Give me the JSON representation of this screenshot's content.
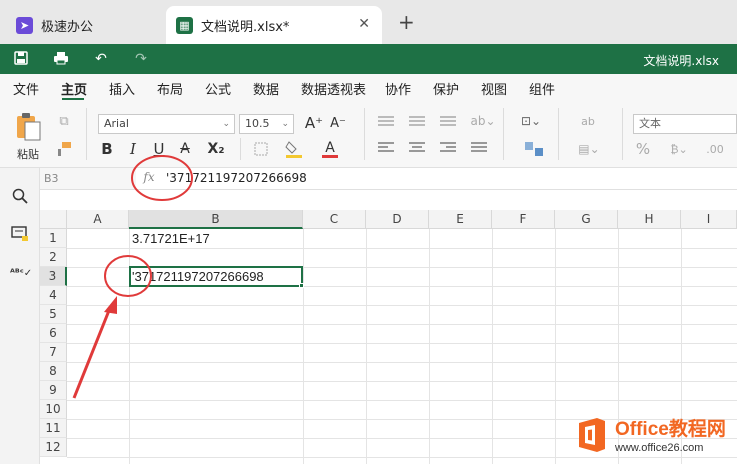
{
  "tabs": [
    {
      "label": "极速办公",
      "icon": "rocket-icon"
    },
    {
      "label": "文档说明.xlsx*",
      "icon": "spreadsheet-icon",
      "close": "✕"
    }
  ],
  "tab_add": "+",
  "title": "文档说明.xlsx",
  "menu": [
    "文件",
    "主页",
    "插入",
    "布局",
    "公式",
    "数据",
    "数据透视表",
    "协作",
    "保护",
    "视图",
    "组件"
  ],
  "ribbon": {
    "paste_label": "粘贴",
    "font_name": "Arial",
    "font_size": "10.5",
    "number_format": "文本",
    "bold": "B",
    "italic": "I",
    "underline": "U",
    "strike": "A",
    "subscript": "X₂",
    "font_color": "A",
    "grow": "A⁺",
    "shrink": "A⁻",
    "percent": "%"
  },
  "formula_bar": {
    "cell_ref": "B3",
    "fx": "fx",
    "value": "'371721197207266698"
  },
  "columns": [
    "A",
    "B",
    "C",
    "D",
    "E",
    "F",
    "G",
    "H",
    "I"
  ],
  "rows": [
    "1",
    "2",
    "3",
    "4",
    "5",
    "6",
    "7",
    "8",
    "9",
    "10",
    "11",
    "12"
  ],
  "cells": {
    "B1": "3.71721E+17",
    "B3": "'371721197207266698"
  },
  "selected_cell": "B3",
  "colors": {
    "accent": "#1e7145",
    "annotation": "#e03a3a",
    "watermark": "#f26722"
  },
  "watermark": {
    "brand": "Office教程网",
    "url": "www.office26.com"
  }
}
